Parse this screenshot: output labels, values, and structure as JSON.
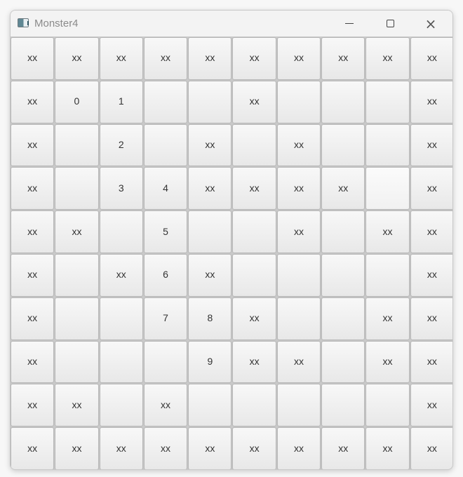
{
  "window": {
    "title": "Monster4",
    "app_icon": "app-window-icon",
    "controls": {
      "minimize_icon": "minimize-icon",
      "maximize_icon": "maximize-icon",
      "close_icon": "close-icon"
    }
  },
  "grid": {
    "rows": [
      [
        "xx",
        "xx",
        "xx",
        "xx",
        "xx",
        "xx",
        "xx",
        "xx",
        "xx",
        "xx"
      ],
      [
        "xx",
        "0",
        "1",
        "",
        "",
        "xx",
        "",
        "",
        "",
        "xx"
      ],
      [
        "xx",
        "",
        "2",
        "",
        "xx",
        "",
        "xx",
        "",
        "",
        "xx"
      ],
      [
        "xx",
        "",
        "3",
        "4",
        "xx",
        "xx",
        "xx",
        "xx",
        "",
        "xx"
      ],
      [
        "xx",
        "xx",
        "",
        "5",
        "",
        "",
        "xx",
        "",
        "xx",
        "xx"
      ],
      [
        "xx",
        "",
        "xx",
        "6",
        "xx",
        "",
        "",
        "",
        "",
        "xx"
      ],
      [
        "xx",
        "",
        "",
        "7",
        "8",
        "xx",
        "",
        "",
        "xx",
        "xx"
      ],
      [
        "xx",
        "",
        "",
        "",
        "9",
        "xx",
        "xx",
        "",
        "xx",
        "xx"
      ],
      [
        "xx",
        "xx",
        "",
        "xx",
        "",
        "",
        "",
        "",
        "",
        "xx"
      ],
      [
        "xx",
        "xx",
        "xx",
        "xx",
        "xx",
        "xx",
        "xx",
        "xx",
        "xx",
        "xx"
      ]
    ]
  }
}
